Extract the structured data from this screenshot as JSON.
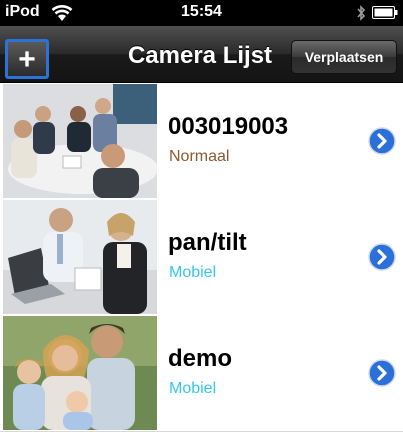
{
  "status_bar": {
    "carrier": "iPod",
    "time": "15:54"
  },
  "nav": {
    "add_label": "+",
    "title": "Camera Lijst",
    "move_label": "Verplaatsen"
  },
  "cameras": [
    {
      "name": "003019003",
      "status": "Normaal",
      "status_color": "#8a5a2e"
    },
    {
      "name": "pan/tilt",
      "status": "Mobiel",
      "status_color": "#33c8f0"
    },
    {
      "name": "demo",
      "status": "Mobiel",
      "status_color": "#33c8f0"
    }
  ],
  "colors": {
    "accent_blue": "#2d72d6",
    "disclosure_blue": "#2b6fd8"
  }
}
